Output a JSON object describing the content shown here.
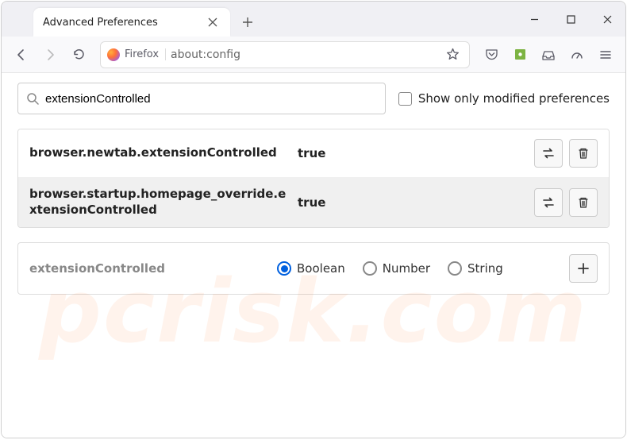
{
  "window": {
    "tab_title": "Advanced Preferences"
  },
  "toolbar": {
    "identity_label": "Firefox",
    "url": "about:config"
  },
  "content": {
    "search_value": "extensionControlled",
    "show_modified_label": "Show only modified preferences",
    "show_modified_checked": false,
    "prefs": [
      {
        "name": "browser.newtab.extensionControlled",
        "value": "true"
      },
      {
        "name": "browser.startup.homepage_override.extensionControlled",
        "value": "true"
      }
    ],
    "new_pref": {
      "name": "extensionControlled",
      "types": [
        "Boolean",
        "Number",
        "String"
      ],
      "selected": "Boolean"
    }
  },
  "watermark": "pcrisk.com"
}
